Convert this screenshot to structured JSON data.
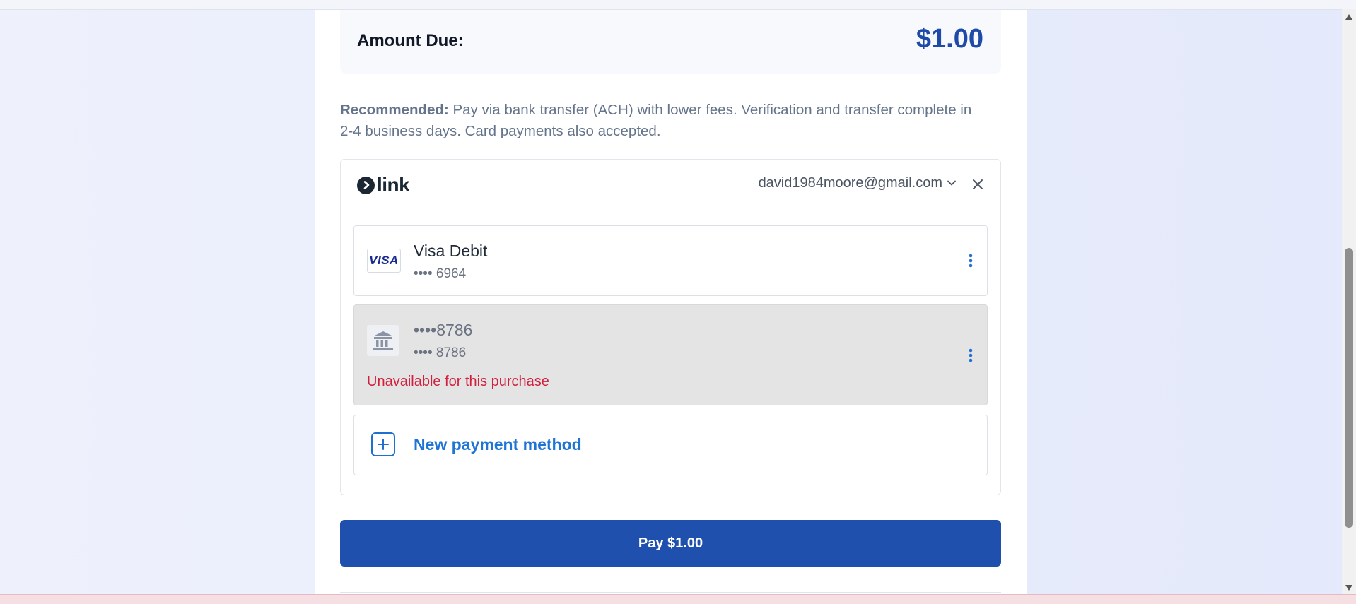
{
  "amount": {
    "label": "Amount Due:",
    "value": "$1.00"
  },
  "recommendation": {
    "strong": "Recommended:",
    "text": " Pay via bank transfer (ACH) with lower fees. Verification and transfer complete in 2-4 business days. Card payments also accepted."
  },
  "link": {
    "brand": "link",
    "email": "david1984moore@gmail.com",
    "icons": {
      "dropdown": "chevron-down-icon",
      "close": "close-icon"
    }
  },
  "payment_methods": [
    {
      "brand_badge": "VISA",
      "title": "Visa Debit",
      "sub": "•••• 6964",
      "icon": "visa-card-icon"
    },
    {
      "title": "••••8786",
      "sub": "•••• 8786",
      "warning": "Unavailable for this purchase",
      "icon": "bank-icon"
    }
  ],
  "new_method": {
    "label": "New payment method",
    "icon": "plus-icon"
  },
  "pay_button": {
    "label": "Pay $1.00"
  },
  "colors": {
    "primary": "#2050ae",
    "accent_blue": "#1f74d4",
    "error": "#d21f3c",
    "amount": "#1e4aa8"
  }
}
